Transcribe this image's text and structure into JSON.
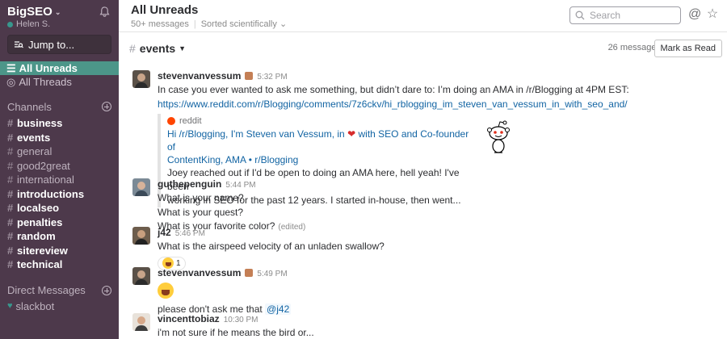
{
  "sidebar": {
    "team_name": "BigSEO",
    "user_name": "Helen S.",
    "jump_label": "Jump to...",
    "nav": [
      {
        "label": "All Unreads"
      },
      {
        "label": "All Threads"
      }
    ],
    "channels_header": "Channels",
    "channels": [
      {
        "name": "business",
        "bold": true
      },
      {
        "name": "events",
        "bold": true
      },
      {
        "name": "general",
        "bold": false
      },
      {
        "name": "good2great",
        "bold": false
      },
      {
        "name": "international",
        "bold": false
      },
      {
        "name": "introductions",
        "bold": true
      },
      {
        "name": "localseo",
        "bold": true
      },
      {
        "name": "penalties",
        "bold": true
      },
      {
        "name": "random",
        "bold": true
      },
      {
        "name": "sitereview",
        "bold": true
      },
      {
        "name": "technical",
        "bold": true
      }
    ],
    "dm_header": "Direct Messages",
    "dms": [
      {
        "name": "slackbot"
      }
    ]
  },
  "header": {
    "title": "All Unreads",
    "count": "50+ messages",
    "sort": "Sorted scientifically",
    "search_placeholder": "Search"
  },
  "channel": {
    "name": "events",
    "message_count": "26 messages",
    "mark_read_label": "Mark as Read"
  },
  "messages": [
    {
      "author": "stevenvanvessum",
      "time": "5:32 PM",
      "lines": [
        "In case you ever wanted to ask me something, but didn’t dare to: I’m doing an AMA in /r/Blogging at 4PM EST:"
      ],
      "link": "https://www.reddit.com/r/Blogging/comments/7z6ckv/hi_rblogging_im_steven_van_vessum_in_with_seo_and/",
      "preview": {
        "source": "reddit",
        "title_1": "Hi /r/Blogging, I'm Steven van Vessum, in",
        "title_1b": "with SEO and Co-founder of",
        "title_2": "ContentKing, AMA • r/Blogging",
        "desc_1": "Joey reached out if I'd be open to doing an AMA here, hell yeah! I've been",
        "desc_2": "working in SEO for the past 12 years. I started in-house, then went..."
      }
    },
    {
      "author": "guthepenguin",
      "time": "5:44 PM",
      "lines": [
        "What is your name?",
        "What is your quest?",
        "What is your favorite color?"
      ],
      "edited": "(edited)"
    },
    {
      "author": "j42",
      "time": "5:46 PM",
      "lines": [
        "What is the airspeed velocity of an unladen swallow?"
      ],
      "reaction_count": "1"
    },
    {
      "author": "stevenvanvessum",
      "time": "5:49 PM",
      "text_before_mention": "please don't ask me that",
      "mention": "@j42"
    },
    {
      "author": "vincenttobiaz",
      "time": "10:30 PM",
      "lines": [
        "i'm not sure if he means the bird or..."
      ]
    }
  ]
}
